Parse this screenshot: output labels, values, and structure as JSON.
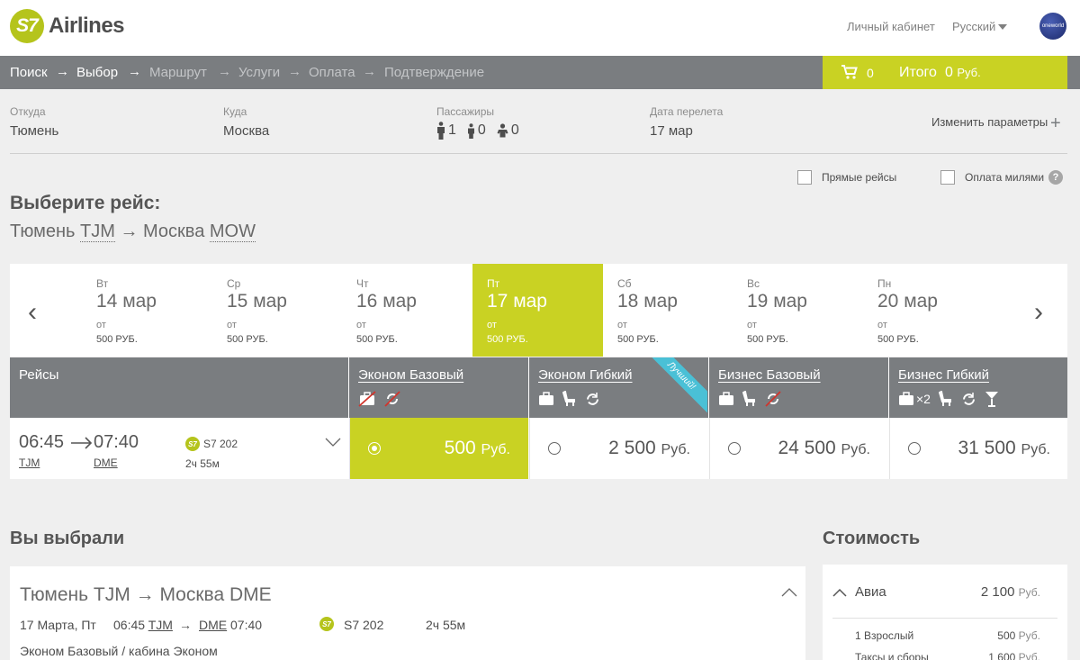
{
  "header": {
    "brand_mark": "S7",
    "brand_name": "Airlines",
    "account_link": "Личный кабинет",
    "language": "Русский",
    "alliance": "oneworld"
  },
  "steps": [
    {
      "label": "Поиск",
      "state": "done"
    },
    {
      "label": "Выбор",
      "state": "current"
    },
    {
      "label": "Маршрут",
      "state": "pending"
    },
    {
      "label": "Услуги",
      "state": "pending"
    },
    {
      "label": "Оплата",
      "state": "pending"
    },
    {
      "label": "Подтверждение",
      "state": "pending"
    }
  ],
  "cart": {
    "count": "0",
    "total_label": "Итого",
    "total_value": "0",
    "currency": "Руб."
  },
  "search": {
    "from_label": "Откуда",
    "from_value": "Тюмень",
    "to_label": "Куда",
    "to_value": "Москва",
    "pax_label": "Пассажиры",
    "adults": "1",
    "children": "0",
    "infants": "0",
    "date_label": "Дата перелета",
    "date_value": "17 мар",
    "change_label": "Изменить параметры"
  },
  "filters": {
    "direct": "Прямые рейсы",
    "miles": "Оплата милями",
    "help": "?"
  },
  "choose_title": "Выберите рейс:",
  "route": {
    "from_city": "Тюмень",
    "from_code": "TJM",
    "to_city": "Москва",
    "to_code": "MOW"
  },
  "dates": [
    {
      "dow": "Вт",
      "date": "14 мар",
      "from": "от",
      "price": "500 РУБ."
    },
    {
      "dow": "Ср",
      "date": "15 мар",
      "from": "от",
      "price": "500 РУБ."
    },
    {
      "dow": "Чт",
      "date": "16 мар",
      "from": "от",
      "price": "500 РУБ."
    },
    {
      "dow": "Пт",
      "date": "17 мар",
      "from": "от",
      "price": "500 РУБ."
    },
    {
      "dow": "Сб",
      "date": "18 мар",
      "from": "от",
      "price": "500 РУБ."
    },
    {
      "dow": "Вс",
      "date": "19 мар",
      "from": "от",
      "price": "500 РУБ."
    },
    {
      "dow": "Пн",
      "date": "20 мар",
      "from": "от",
      "price": "500 РУБ."
    }
  ],
  "fares_header": "Рейсы",
  "fares": [
    {
      "name": "Эконом Базовый",
      "price": "500",
      "currency": "Руб.",
      "extra": ""
    },
    {
      "name": "Эконом Гибкий",
      "price": "2 500",
      "currency": "Руб.",
      "ribbon": "Лучший!"
    },
    {
      "name": "Бизнес Базовый",
      "price": "24 500",
      "currency": "Руб."
    },
    {
      "name": "Бизнес Гибкий",
      "price": "31 500",
      "currency": "Руб.",
      "bag_multiplier": "×2"
    }
  ],
  "flight": {
    "dep_time": "06:45",
    "arr_time": "07:40",
    "dep_code": "TJM",
    "arr_code": "DME",
    "number": "S7 202",
    "duration": "2ч 55м",
    "badge": "S7"
  },
  "selected_title": "Вы выбрали",
  "selected": {
    "from_city": "Тюмень",
    "from_code": "TJM",
    "to_city": "Москва",
    "to_code": "DME",
    "date": "17 Марта, Пт",
    "dep_time": "06:45",
    "dep_code": "TJM",
    "arr_code": "DME",
    "arr_time": "07:40",
    "badge": "S7",
    "number": "S7 202",
    "duration": "2ч 55м",
    "cabin": "Эконом Базовый / кабина Эконом"
  },
  "cost_title": "Стоимость",
  "cost": {
    "avia_label": "Авиа",
    "avia_value": "2 100",
    "currency": "Руб.",
    "lines": [
      {
        "label": "1 Взрослый",
        "value": "500",
        "currency": "Руб."
      },
      {
        "label": "Таксы и сборы",
        "value": "1 600",
        "currency": "Руб."
      }
    ]
  },
  "colors": {
    "accent": "#c9d223",
    "bar": "#7a7d80",
    "ribbon": "#4ac0d6"
  }
}
